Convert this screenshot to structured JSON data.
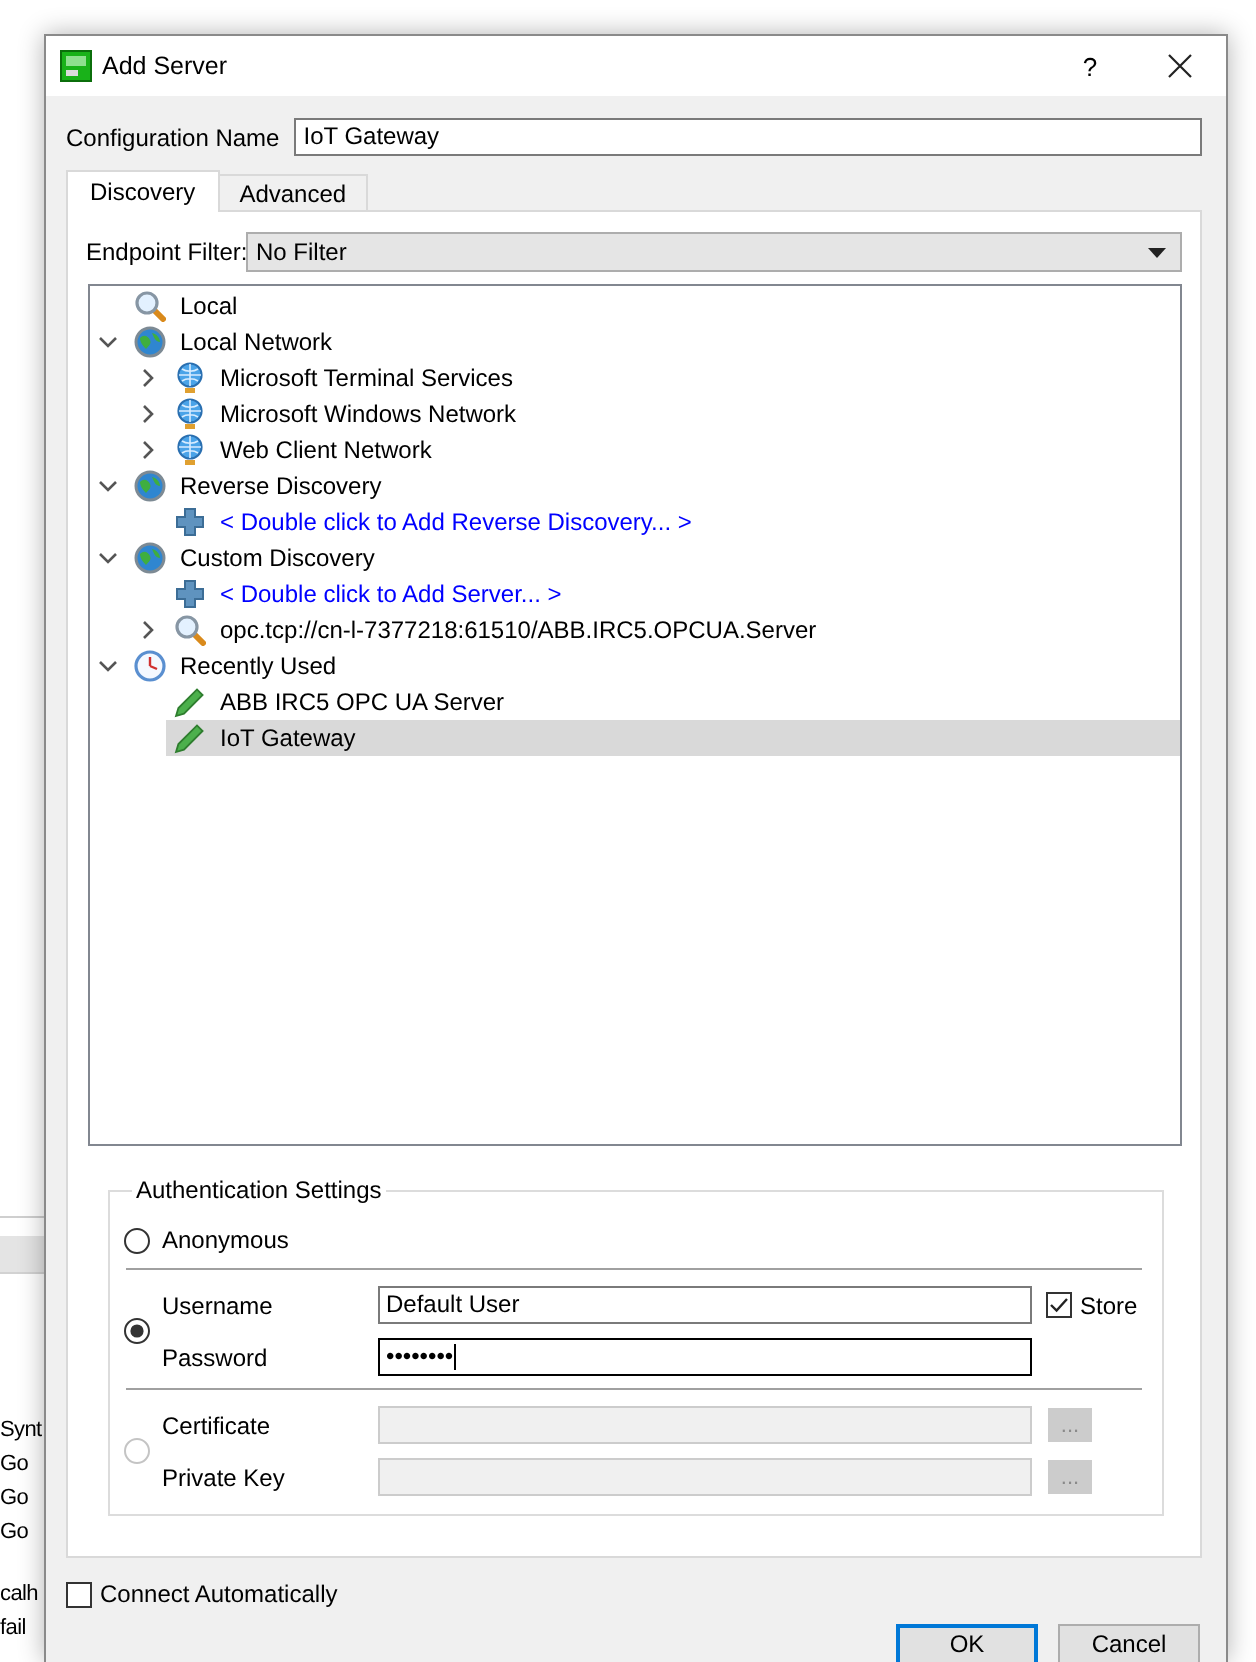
{
  "window": {
    "title": "Add Server",
    "help": "?"
  },
  "configuration_name": {
    "label": "Configuration Name",
    "value": "IoT Gateway"
  },
  "tabs": [
    {
      "label": "Discovery",
      "selected": true
    },
    {
      "label": "Advanced",
      "selected": false
    }
  ],
  "endpoint_filter": {
    "label": "Endpoint Filter:",
    "value": "No Filter"
  },
  "tree": [
    {
      "kind": "search",
      "label": "Local",
      "selected": false
    },
    {
      "kind": "network",
      "label": "Local Network",
      "expanded": true,
      "selected": false,
      "children": [
        {
          "kind": "host",
          "label": "Microsoft Terminal Services",
          "expanded": false,
          "selected": false
        },
        {
          "kind": "host",
          "label": "Microsoft Windows Network",
          "expanded": false,
          "selected": false
        },
        {
          "kind": "host",
          "label": "Web Client Network",
          "expanded": false,
          "selected": false
        }
      ]
    },
    {
      "kind": "network",
      "label": "Reverse Discovery",
      "expanded": true,
      "selected": false,
      "children": [
        {
          "kind": "link",
          "label": "< Double click to Add Reverse Discovery... >",
          "selected": false
        }
      ]
    },
    {
      "kind": "network",
      "label": "Custom Discovery",
      "expanded": true,
      "selected": false,
      "children": [
        {
          "kind": "link",
          "label": "< Double click to Add Server... >",
          "selected": false
        },
        {
          "kind": "search",
          "label": "opc.tcp://cn-l-7377218:61510/ABB.IRC5.OPCUA.Server",
          "expanded": false,
          "selected": false
        }
      ]
    },
    {
      "kind": "history",
      "label": "Recently Used",
      "expanded": true,
      "selected": false,
      "children": [
        {
          "kind": "server",
          "label": "ABB IRC5 OPC UA Server",
          "selected": false
        },
        {
          "kind": "server",
          "label": "IoT Gateway",
          "selected": true
        }
      ]
    }
  ],
  "authentication": {
    "title": "Authentication Settings",
    "options": [
      {
        "kind": "anonymous",
        "label": "Anonymous",
        "selected": false,
        "disabled": false
      },
      {
        "kind": "credentials",
        "selected": true,
        "disabled": false,
        "fields": [
          {
            "label": "Username",
            "value": "Default User",
            "focused": false
          },
          {
            "label": "Password",
            "value": "••••••••",
            "focused": true
          }
        ],
        "store": {
          "label": "Store",
          "checked": true
        }
      },
      {
        "kind": "certificate",
        "selected": false,
        "disabled": true,
        "fields": [
          {
            "label": "Certificate",
            "button": "..."
          },
          {
            "label": "Private Key",
            "button": "..."
          }
        ]
      }
    ]
  },
  "connect_automatically": {
    "label": "Connect Automatically",
    "checked": false
  },
  "buttons": [
    {
      "label": "OK",
      "default": true
    },
    {
      "label": "Cancel",
      "default": false
    }
  ],
  "background_window": {
    "sections": [
      {
        "lines": [
          "Synt",
          "Go",
          "Go",
          "Go"
        ]
      },
      {
        "lines": [
          "calh",
          "fail"
        ]
      }
    ]
  }
}
